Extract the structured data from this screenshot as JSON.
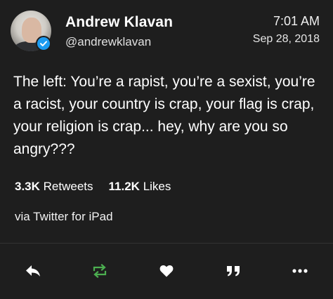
{
  "author": {
    "name": "Andrew Klavan",
    "handle": "@andrewklavan",
    "verified": true
  },
  "tweet": {
    "time": "7:01 AM",
    "date": "Sep 28, 2018",
    "text": "The left: You’re a rapist, you’re a sexist, you’re a racist, your country is crap, your flag is crap, your religion is crap... hey, why are you so angry???",
    "source": "via Twitter for iPad"
  },
  "stats": {
    "retweets_count": "3.3K",
    "retweets_label": "Retweets",
    "likes_count": "11.2K",
    "likes_label": "Likes"
  },
  "actions": [
    {
      "icon": "reply-icon"
    },
    {
      "icon": "retweet-icon",
      "color": "#4caf50"
    },
    {
      "icon": "heart-icon"
    },
    {
      "icon": "quote-icon"
    },
    {
      "icon": "more-icon"
    }
  ],
  "colors": {
    "background": "#1e1e1e",
    "text": "#ffffff",
    "verified": "#1d9bf0",
    "retweet": "#4caf50"
  }
}
